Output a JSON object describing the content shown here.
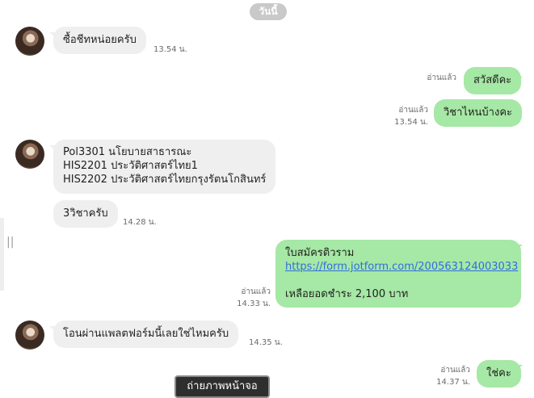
{
  "date_separator": "วันนี้",
  "messages": [
    {
      "id": "m1",
      "side": "incoming",
      "text": "ซื้อชีทหน่อยครับ",
      "time": "13.54 น."
    },
    {
      "id": "m2",
      "side": "outgoing",
      "text": "สวัสดีคะ",
      "read": "อ่านแล้ว"
    },
    {
      "id": "m3",
      "side": "outgoing",
      "text": "วิชาไหนบ้างคะ",
      "read": "อ่านแล้ว",
      "time": "13.54 น."
    },
    {
      "id": "m4",
      "side": "incoming",
      "lines": [
        "Pol3301 นโยบายสาธารณะ",
        "HIS2201 ประวัติศาสตร์ไทย1",
        "HIS2202 ประวัติศาสตร์ไทยกรุงรัตนโกสินทร์"
      ]
    },
    {
      "id": "m5",
      "side": "incoming",
      "text": "3วิชาครับ",
      "time": "14.28 น."
    },
    {
      "id": "m6",
      "side": "outgoing",
      "title": "ใบสมัครติวราม",
      "link": "https://form.jotform.com/200563124003033",
      "amount": "เหลือยอดชำระ 2,100 บาท",
      "read": "อ่านแล้ว",
      "time": "14.33 น."
    },
    {
      "id": "m7",
      "side": "incoming",
      "text": "โอนผ่านแพลตฟอร์มนี้เลยใช่ไหมครับ",
      "time": "14.35 น."
    },
    {
      "id": "m8",
      "side": "outgoing",
      "text": "ใช่คะ",
      "read": "อ่านแล้ว",
      "time": "14.37 น."
    }
  ],
  "screenshot_button": "ถ่ายภาพหน้าจอ",
  "left_grip": "||",
  "colors": {
    "incoming_bubble": "#efefef",
    "outgoing_bubble": "#a6e8a5",
    "link": "#2f6ee0",
    "date_pill": "#c9c9c9"
  }
}
